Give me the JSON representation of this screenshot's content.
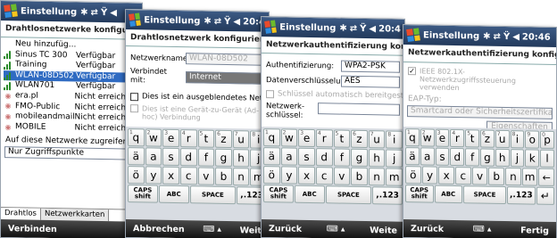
{
  "screens": [
    {
      "title": "Einstellung",
      "heading": "Drahtlosnetzwerke konfigurieren",
      "networks": [
        {
          "name": "Neu hinzufüg...",
          "status": "",
          "icon": "none"
        },
        {
          "name": "Sinus TC 300",
          "status": "Verfügbar",
          "icon": "signal-bars-icon"
        },
        {
          "name": "Training",
          "status": "Verfügbar",
          "icon": "signal-bars-icon"
        },
        {
          "name": "WLAN-08D502",
          "status": "Verfügbar",
          "icon": "signal-bars-icon",
          "selected": true
        },
        {
          "name": "WLAN701",
          "status": "Verfügbar",
          "icon": "signal-bars-icon"
        },
        {
          "name": "era.pl",
          "status": "Nicht erreichbar",
          "icon": "network-globe-icon"
        },
        {
          "name": "FMO-Public",
          "status": "Nicht erreichbar",
          "icon": "network-globe-icon"
        },
        {
          "name": "mobileandmail",
          "status": "Nicht erreichbar",
          "icon": "network-globe-icon"
        },
        {
          "name": "MOBILE",
          "status": "Nicht erreichbar",
          "icon": "network-globe-icon"
        }
      ],
      "access_label": "Auf diese Netzwerke zugreifen:",
      "access_value": "Nur Zugriffspunkte",
      "tabs": [
        "Drahtlos",
        "Netzwerkkarten"
      ],
      "softkey_left": "Verbinden"
    },
    {
      "title": "Einstellung",
      "time": "20:4",
      "heading": "Drahtlosnetzwerk konfigurieren",
      "network_name_label": "Netzwerkname:",
      "network_name_value": "WLAN-08D502",
      "connect_label": "Verbindet mit:",
      "connect_value": "Internet",
      "hidden_network_label": "Dies ist ein ausgeblendetes Netzwerk",
      "adhoc_label": "Dies ist eine Gerät-zu-Gerät (Ad-hoc) Verbindung",
      "softkey_left": "Abbrechen",
      "softkey_right": "Weit"
    },
    {
      "title": "Einstellung",
      "time": "20:4",
      "heading": "Netzwerkauthentifizierung konfig.",
      "auth_label": "Authentifizierung:",
      "auth_value": "WPA2-PSK",
      "enc_label": "Datenverschlüsselung:",
      "enc_value": "AES",
      "auto_key_label": "Schlüssel automatisch bereitgestellt",
      "netkey_label": "Netzwerk-schlüssel:",
      "softkey_left": "Zurück",
      "softkey_right": "Weite"
    },
    {
      "title": "Einstellung",
      "time": "20:46",
      "heading": "Netzwerkauthentifizierung konfig.",
      "ieee_label": "IEEE 802.1X-Netzwerkzugriffssteuerung verwenden",
      "eap_label": "EAP-Typ:",
      "eap_value": "Smartcard oder Sicherheitszertifikat",
      "properties_label": "Eigenschaften",
      "softkey_left": "Zurück",
      "softkey_right": "Fertig"
    }
  ],
  "keyboard": {
    "row1": [
      "q",
      "w",
      "e",
      "r",
      "t",
      "z",
      "u",
      "i",
      "o",
      "p"
    ],
    "row1_sup": [
      "1",
      "2",
      "3",
      "4",
      "5",
      "6",
      "7",
      "8",
      "9",
      "0"
    ],
    "row2": [
      "a",
      "s",
      "d",
      "f",
      "g",
      "h",
      "j",
      "k",
      "l",
      "ü"
    ],
    "row3": [
      "y",
      "x",
      "c",
      "v",
      "b",
      "n",
      "m",
      ",",
      "."
    ],
    "row4": [
      "CAPS shift",
      "ABC",
      "SPACE",
      ",.123"
    ],
    "special": [
      "ä",
      "ö",
      "ß",
      "é",
      "ç",
      "ñ",
      "←"
    ]
  },
  "colors": {
    "titlebar": "#233a5c",
    "selection": "#2f6bc2",
    "softbar": "#111111"
  }
}
